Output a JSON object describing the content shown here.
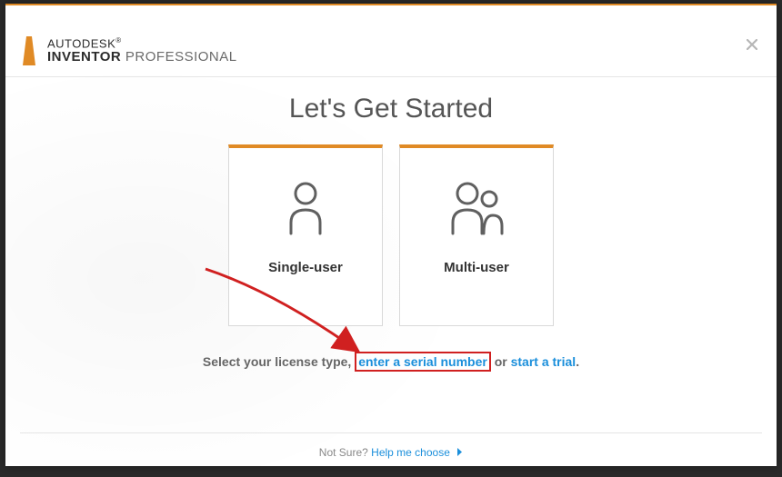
{
  "brand": {
    "row1": "AUTODESK",
    "tm": "®",
    "row2_bold": "INVENTOR",
    "row2_light": "PROFESSIONAL"
  },
  "title": "Let's Get Started",
  "cards": {
    "single": {
      "label": "Single-user"
    },
    "multi": {
      "label": "Multi-user"
    }
  },
  "prompt": {
    "lead": "Select your license type",
    "comma": ", ",
    "serial_link": "enter a serial number",
    "or": " or ",
    "trial_link": "start a trial",
    "dot": "."
  },
  "footer": {
    "not_sure": "Not Sure?",
    "help_link": "Help me choose"
  },
  "colors": {
    "accent": "#e08a25",
    "link": "#1b8fdb",
    "annotation": "#d02020"
  }
}
